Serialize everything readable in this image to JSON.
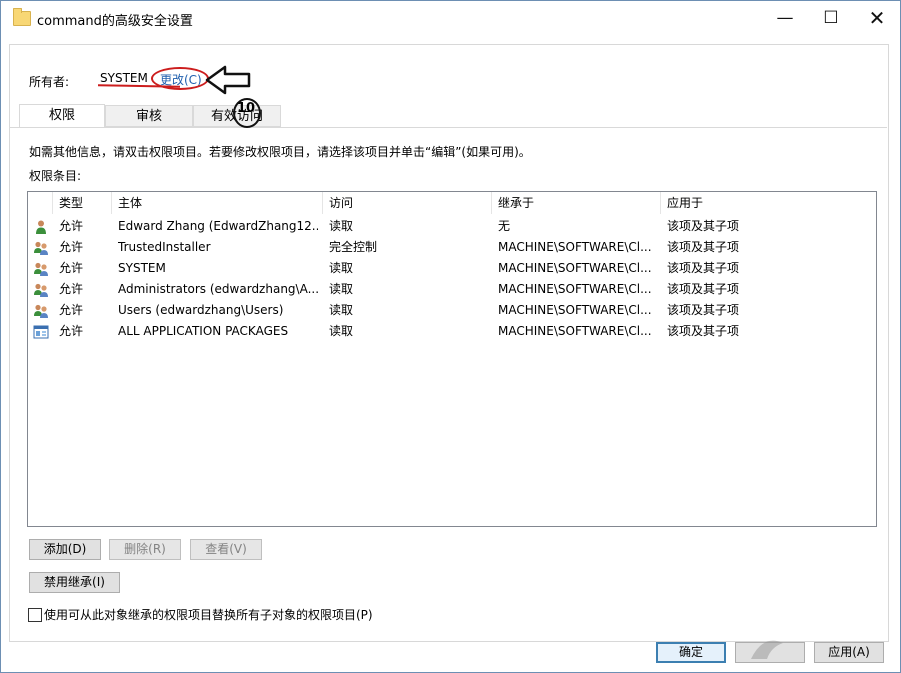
{
  "window": {
    "title": "command的高级安全设置"
  },
  "owner": {
    "label": "所有者:",
    "value": "SYSTEM",
    "change_link": "更改(C)"
  },
  "annotation": {
    "number": "10"
  },
  "tabs": [
    {
      "label": "权限",
      "active": true
    },
    {
      "label": "审核",
      "active": false
    },
    {
      "label": "有效访问",
      "active": false
    }
  ],
  "info_text": "如需其他信息，请双击权限项目。若要修改权限项目，请选择该项目并单击“编辑”(如果可用)。",
  "entries_label": "权限条目:",
  "columns": [
    "类型",
    "主体",
    "访问",
    "继承于",
    "应用于"
  ],
  "rows": [
    {
      "icon": "user-icon",
      "type": "允许",
      "principal": "Edward Zhang (EdwardZhang12...",
      "access": "读取",
      "inherited": "无",
      "applies": "该项及其子项"
    },
    {
      "icon": "user-group-icon",
      "type": "允许",
      "principal": "TrustedInstaller",
      "access": "完全控制",
      "inherited": "MACHINE\\SOFTWARE\\Cl...",
      "applies": "该项及其子项"
    },
    {
      "icon": "user-group-icon",
      "type": "允许",
      "principal": "SYSTEM",
      "access": "读取",
      "inherited": "MACHINE\\SOFTWARE\\Cl...",
      "applies": "该项及其子项"
    },
    {
      "icon": "user-group-icon",
      "type": "允许",
      "principal": "Administrators (edwardzhang\\A...",
      "access": "读取",
      "inherited": "MACHINE\\SOFTWARE\\Cl...",
      "applies": "该项及其子项"
    },
    {
      "icon": "user-group-icon",
      "type": "允许",
      "principal": "Users (edwardzhang\\Users)",
      "access": "读取",
      "inherited": "MACHINE\\SOFTWARE\\Cl...",
      "applies": "该项及其子项"
    },
    {
      "icon": "app-packages-icon",
      "type": "允许",
      "principal": "ALL APPLICATION PACKAGES",
      "access": "读取",
      "inherited": "MACHINE\\SOFTWARE\\Cl...",
      "applies": "该项及其子项"
    }
  ],
  "buttons": {
    "add": "添加(D)",
    "remove": "删除(R)",
    "view": "查看(V)",
    "disable_inheritance": "禁用继承(I)",
    "ok": "确定",
    "apply": "应用(A)"
  },
  "checkbox": {
    "label": "使用可从此对象继承的权限项目替换所有子对象的权限项目(P)",
    "checked": false
  },
  "colors": {
    "annotation_red": "#cc1d1d",
    "link_blue": "#1f5fae"
  }
}
